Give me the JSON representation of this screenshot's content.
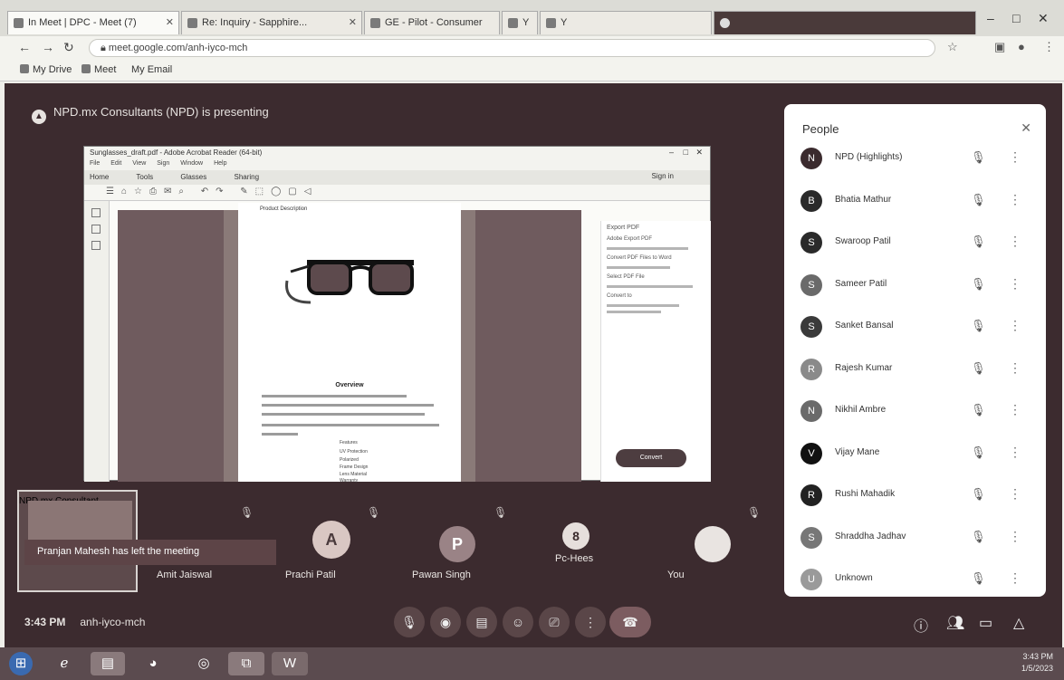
{
  "browser": {
    "tabs": [
      "In Meet | DPC - Meet (7)",
      "Re: Inquiry - Sapphire...",
      "GE - Pilot - Consumer",
      "Y",
      "Y"
    ],
    "address": "meet.google.com/anh-iyco-mch",
    "bookmarks": [
      "My Drive",
      "Meet",
      "My Email"
    ],
    "controls": {
      "minimize": "–",
      "maximize": "□",
      "close": "✕"
    }
  },
  "meet": {
    "presenter_text": "NPD.mx Consultants (NPD) is presenting",
    "shared_screen": {
      "window_title": "Sunglasses_draft.pdf - Adobe Acrobat Reader (64-bit)",
      "menus": [
        "File",
        "Edit",
        "View",
        "Sign",
        "Window",
        "Help"
      ],
      "tabs": [
        "Home",
        "Tools",
        "Glasses",
        "Sharing"
      ],
      "share_label": "Sign in",
      "doc_caption": "Product Description",
      "doc_heading": "Overview",
      "doc_list": [
        "Features",
        "UV Protection",
        "Polarized",
        "Frame Design",
        "Lens Material",
        "Warranty"
      ],
      "panel_head": "Export PDF",
      "panel_rows": [
        "Adobe Export PDF",
        "Convert PDF Files to Word",
        "Select PDF File",
        "Convert to"
      ],
      "panel_button": "Convert"
    },
    "tiles": [
      {
        "name": "NPD.mx Consultant",
        "kind": "self"
      },
      {
        "name": "Amit Jaiswal"
      },
      {
        "name": "Prachi Patil",
        "initials": "A"
      },
      {
        "name": "Pawan Singh",
        "initials": "P"
      },
      {
        "name": "Pc-Hees",
        "initials": "8"
      },
      {
        "name": "You"
      }
    ],
    "toast": "Pranjan Mahesh has left the meeting",
    "time": "3:43 PM",
    "meeting_code": "anh-iyco-mch",
    "controls": [
      "mic",
      "camera",
      "captions",
      "reactions",
      "present",
      "more",
      "end"
    ],
    "right_controls": [
      "info",
      "people",
      "chat",
      "activities"
    ]
  },
  "people_panel": {
    "title": "People",
    "members": [
      {
        "name": "NPD (Highlights)",
        "initial": "N",
        "color": "#3b2b2e"
      },
      {
        "name": "Bhatia Mathur",
        "initial": "B",
        "color": "#2a2a2a"
      },
      {
        "name": "Swaroop Patil",
        "initial": "S",
        "color": "#2a2a2a"
      },
      {
        "name": "Sameer Patil",
        "initial": "S",
        "color": "#6a6a6a"
      },
      {
        "name": "Sanket Bansal",
        "initial": "S",
        "color": "#3a3a3a"
      },
      {
        "name": "Rajesh Kumar",
        "initial": "R",
        "color": "#8a8a8a"
      },
      {
        "name": "Nikhil Ambre",
        "initial": "N",
        "color": "#6a6a6a"
      },
      {
        "name": "Vijay Mane",
        "initial": "V",
        "color": "#111111"
      },
      {
        "name": "Rushi Mahadik",
        "initial": "R",
        "color": "#222222"
      },
      {
        "name": "Shraddha Jadhav",
        "initial": "S",
        "color": "#777777"
      },
      {
        "name": "Unknown",
        "initial": "U",
        "color": "#9a9a9a"
      }
    ]
  },
  "taskbar": {
    "clock_time": "3:43 PM",
    "clock_date": "1/5/2023"
  }
}
